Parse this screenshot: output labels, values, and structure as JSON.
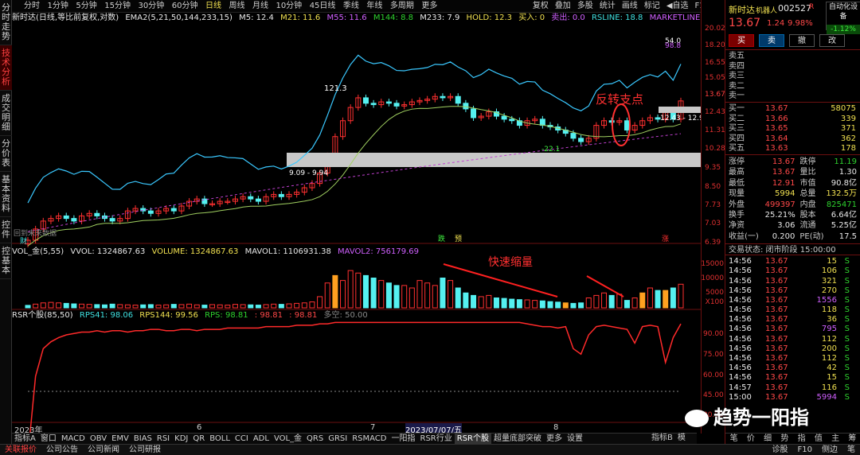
{
  "left_tabs": [
    "分时走势",
    "技术分析",
    "成交明细",
    "分价表",
    "基本资料",
    "控件",
    "控基本"
  ],
  "period_bar": [
    "分时",
    "1分钟",
    "5分钟",
    "15分钟",
    "30分钟",
    "60分钟",
    "日线",
    "周线",
    "月线",
    "10分钟",
    "45日线",
    "季线",
    "年线",
    "多周期",
    "更多"
  ],
  "right_tools": [
    "复权",
    "叠加",
    "多股",
    "统计",
    "画线",
    "标记",
    "◀自选",
    "F10"
  ],
  "ind1": {
    "name": "新时达(日线,等比前复权,对数)",
    "ema2": "EMA2(5,21,50,144,233,15)",
    "m5": "M5: 12.4",
    "m21": "M21: 11.6",
    "m55": "M55: 11.6",
    "m144": "M144: 8.8",
    "m233": "M233: 7.9",
    "hold": "HOLD: 12.3",
    "buy": "买入: 0",
    "sell": "卖出: 0.0",
    "rsline": "RSLINE: 18.8",
    "mkt": "MARKETLINE: 19.2"
  },
  "yaxis_main": [
    "20.02",
    "18.20",
    "16.55",
    "15.05",
    "13.67",
    "12.43",
    "11.31",
    "10.28",
    "9.35",
    "8.50",
    "7.73",
    "7.03",
    "6.39"
  ],
  "annot": {
    "high": "121.3",
    "peak": "54.0",
    "peak2": "98.8",
    "range": "9.09 - 9.94",
    "low": "-22.1",
    "right_range": "12.43 - 12.9",
    "reverse": "反转支点",
    "shrink": "快速缩量",
    "fall": "跌",
    "hold": "预",
    "rise": "涨",
    "future": "回到未来数据",
    "fin": "财"
  },
  "ind2": {
    "name": "VOL_金(5,55)",
    "vvol": "VVOL: 1324867.63",
    "volume": "VOLUME: 1324867.63",
    "mavol1": "MAVOL1: 1106931.38",
    "mavol2": "MAVOL2: 756179.69"
  },
  "yaxis_vol": [
    "15000",
    "10000",
    "5000",
    "X100"
  ],
  "ind3": {
    "name": "RSR个股(85,50)",
    "rps41": "RPS41: 98.06",
    "rps144": "RPS144: 99.56",
    "rps": "RPS: 98.81",
    "v1": ": 98.81",
    "v2": ": 98.81",
    "ds": "多空: 50.00"
  },
  "yaxis_rsr": [
    "90.00",
    "75.00",
    "60.00",
    "45.00",
    "30.00",
    "15.00"
  ],
  "xlabels": [
    "2023年",
    "6",
    "7",
    "2023/07/07/五",
    "8"
  ],
  "bottom_tabs": [
    "指标A",
    "窗口",
    "MACD",
    "OBV",
    "EMV",
    "BIAS",
    "RSI",
    "KDJ",
    "QR",
    "BOLL",
    "CCI",
    "ADL",
    "VOL_金",
    "QRS",
    "GRSI",
    "RSMACD",
    "一阳指",
    "RSR行业",
    "RSR个股",
    "超量底部突破",
    "更多",
    "设置"
  ],
  "bottom_right": [
    "指标B",
    "模",
    "|"
  ],
  "status": [
    "关联报价",
    "公司公告",
    "公司新闻",
    "公司研报"
  ],
  "status_right": [
    "诊股",
    "F10",
    "侧边",
    "笔"
  ],
  "stock": {
    "name": "新时达",
    "tag": "机器人",
    "code": "002527",
    "mark": "R",
    "price": "13.67",
    "chg": "1.24",
    "pct": "9.98%",
    "self": "自动化设备",
    "self_pct": "-1.12%"
  },
  "actions": [
    "买",
    "卖",
    "撤",
    "改"
  ],
  "sell_levels": [
    "卖五",
    "卖四",
    "卖三",
    "卖二",
    "卖一"
  ],
  "buy_levels": [
    {
      "l": "买一",
      "p": "13.67",
      "v": "58075"
    },
    {
      "l": "买二",
      "p": "13.66",
      "v": "339"
    },
    {
      "l": "买三",
      "p": "13.65",
      "v": "371"
    },
    {
      "l": "买四",
      "p": "13.64",
      "v": "362"
    },
    {
      "l": "买五",
      "p": "13.63",
      "v": "178"
    }
  ],
  "quote": [
    [
      "涨停",
      "13.67",
      "跌停",
      "11.19"
    ],
    [
      "最高",
      "13.67",
      "量比",
      "1.30"
    ],
    [
      "最低",
      "12.91",
      "市值",
      "90.8亿"
    ],
    [
      "现量",
      "5994",
      "总量",
      "132.5万"
    ],
    [
      "外盘",
      "499397",
      "内盘",
      "825471"
    ],
    [
      "换手",
      "25.21%",
      "股本",
      "6.64亿"
    ],
    [
      "净资",
      "3.06",
      "流通",
      "5.25亿"
    ],
    [
      "收益(一)",
      "0.200",
      "PE(动)",
      "17.5"
    ]
  ],
  "trade_state": "交易状态: 闭市阶段 15:00:00",
  "ticks": [
    [
      "14:56",
      "13.67",
      "15",
      "S"
    ],
    [
      "14:56",
      "13.67",
      "106",
      "S"
    ],
    [
      "14:56",
      "13.67",
      "321",
      "S"
    ],
    [
      "14:56",
      "13.67",
      "270",
      "S"
    ],
    [
      "14:56",
      "13.67",
      "1556",
      "S"
    ],
    [
      "14:56",
      "13.67",
      "118",
      "S"
    ],
    [
      "14:56",
      "13.67",
      "36",
      "S"
    ],
    [
      "14:56",
      "13.67",
      "795",
      "S"
    ],
    [
      "14:56",
      "13.67",
      "112",
      "S"
    ],
    [
      "14:56",
      "13.67",
      "200",
      "S"
    ],
    [
      "14:56",
      "13.67",
      "112",
      "S"
    ],
    [
      "14:56",
      "13.67",
      "42",
      "S"
    ],
    [
      "14:56",
      "13.67",
      "15",
      "S"
    ],
    [
      "14:57",
      "13.67",
      "116",
      "S"
    ],
    [
      "15:00",
      "13.67",
      "5994",
      "S"
    ]
  ],
  "tick_tabs": [
    "笔",
    "价",
    "细",
    "势",
    "指",
    "值",
    "主",
    "筹"
  ],
  "tick_extra": "352",
  "watermark": "趋势一阳指",
  "colors": {
    "up": "#ff4040",
    "down": "#55f0f0",
    "bg": "#000000",
    "accent": "#e03030"
  }
}
